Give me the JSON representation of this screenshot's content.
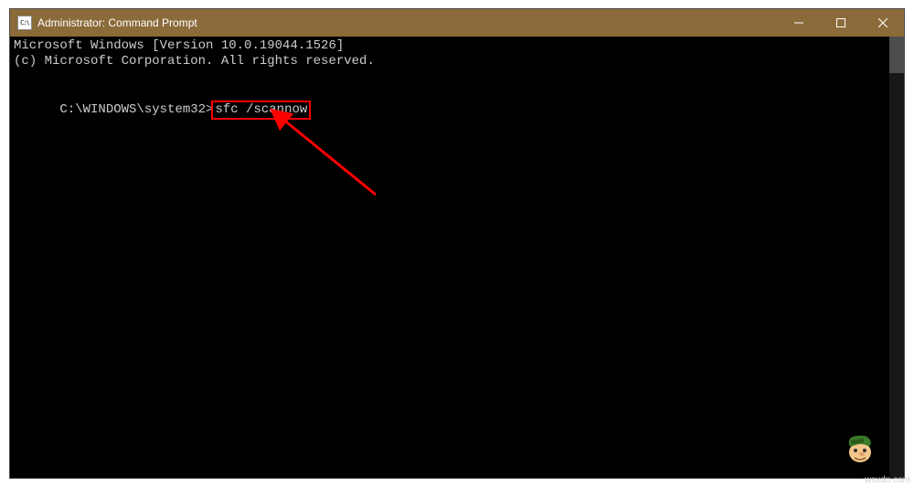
{
  "window": {
    "title": "Administrator: Command Prompt",
    "icon_label": "C:\\"
  },
  "terminal": {
    "line1": "Microsoft Windows [Version 10.0.19044.1526]",
    "line2": "(c) Microsoft Corporation. All rights reserved.",
    "prompt": "C:\\WINDOWS\\system32>",
    "command": "sfc /scannow"
  },
  "controls": {
    "minimize": "minimize",
    "maximize": "maximize",
    "close": "close"
  },
  "watermark": "wsxdn.com"
}
